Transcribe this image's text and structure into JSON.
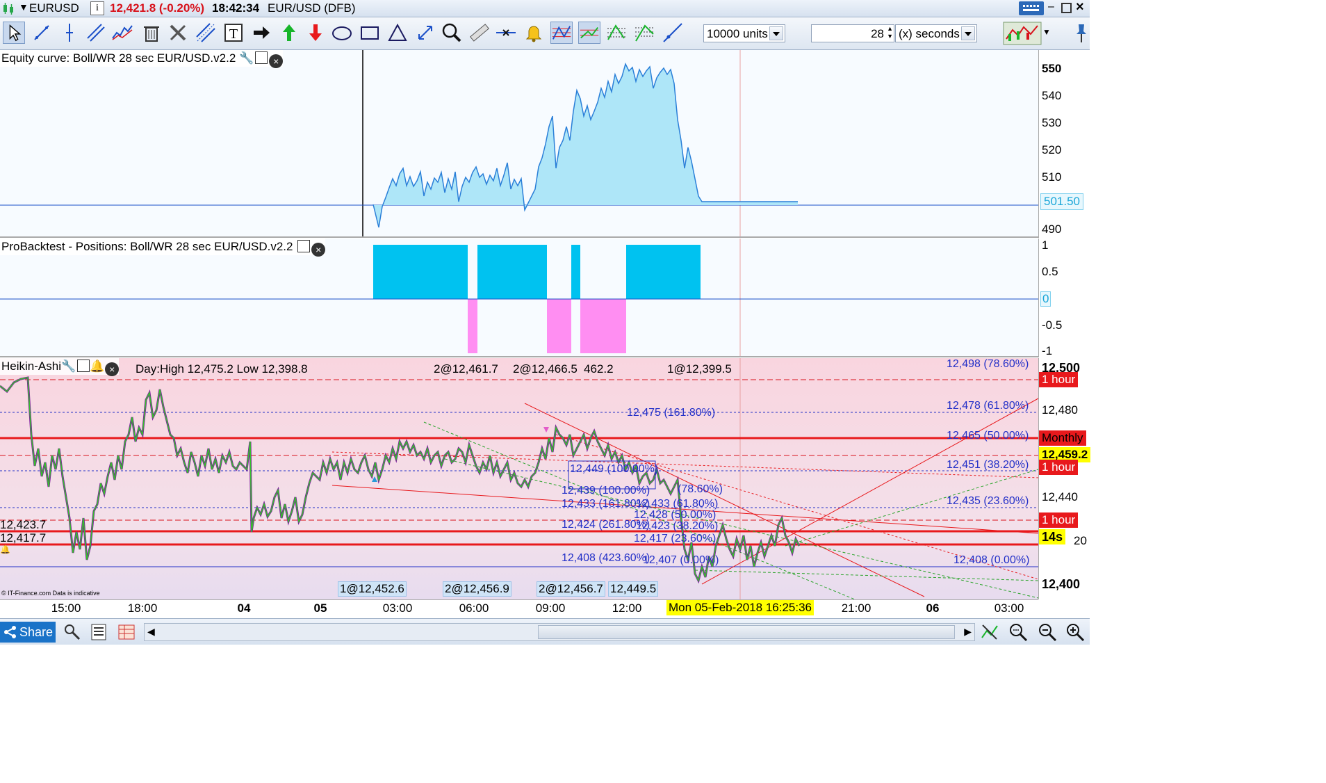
{
  "window": {
    "symbol": "EURUSD",
    "info_icon": "i",
    "price_change": "12,421.8 (-0.20%)",
    "time": "18:42:34",
    "instrument": "EUR/USD (DFB)"
  },
  "toolbar": {
    "units_value": "10000 units",
    "period_value": "28",
    "period_unit": "(x) seconds"
  },
  "equity_panel": {
    "label": "Equity curve: Boll/WR 28 sec EUR/USD.v2.2",
    "ticks": [
      "550",
      "540",
      "530",
      "520",
      "510",
      "490"
    ],
    "last_value": "501.50"
  },
  "positions_panel": {
    "label": "ProBacktest - Positions: Boll/WR 28 sec EUR/USD.v2.2",
    "ticks": [
      "1",
      "0.5",
      "-0.5",
      "-1"
    ],
    "zero_value": "0"
  },
  "price_panel": {
    "label": "Heikin-Ashi",
    "day_info": "Day:High 12,475.2 Low 12,398.8",
    "top_orders": [
      "2@12,461.7",
      "2@12,466.5",
      "462.2",
      "1@12,399.5"
    ],
    "bottom_orders": [
      "1@12,452.6",
      "2@12,456.9",
      "2@12,456.7",
      "12,449.5"
    ],
    "left_levels": [
      "12,423.7",
      "12,417.7"
    ],
    "fib_right": [
      "12,498 (78.60%)",
      "12,478 (61.80%)",
      "12,465 (50.00%)",
      "12,451 (38.20%)",
      "12,435 (23.60%)",
      "12,408 (0.00%)"
    ],
    "fib_mid": [
      "12,475 (161.80%)",
      "12,449 (100.00%)",
      "12,439 (100.00%)",
      "(78.60%)",
      "12,433 (161.80%)",
      "12,433 (61.80%)",
      "12,428 (50.00%)",
      "12,424 (261.80%)",
      "12,423 (38.20%)",
      "12,417 (23.60%)",
      "12,408 (423.60%)",
      "12,407 (0.00%)"
    ],
    "ticks": [
      "12,500",
      "12,480",
      "12,440",
      "12,400"
    ],
    "flags": [
      "1 hour",
      "Monthly",
      "12,459.2",
      "1 hour",
      "1 hour",
      "14s"
    ],
    "partial_tick": "20",
    "copyright": "© IT-Finance.com  Data is indicative"
  },
  "time_axis": {
    "labels": [
      "15:00",
      "18:00",
      "04",
      "05",
      "03:00",
      "06:00",
      "09:00",
      "12:00",
      "21:00",
      "06",
      "03:00"
    ],
    "cursor_label": "Mon 05-Feb-2018 16:25:36"
  },
  "bottom": {
    "share_label": "Share"
  },
  "colors": {
    "equity_fill": "#aee6f8",
    "long_position": "#00c2f0",
    "short_position": "#ff8ef2",
    "price_bg": "#f9d9e2",
    "price_line": "#36c12b",
    "price_outline": "#7b1a9e",
    "support_red": "#e8191c",
    "fib_blue": "#2330c8",
    "cursor_flag": "#ffff00"
  }
}
